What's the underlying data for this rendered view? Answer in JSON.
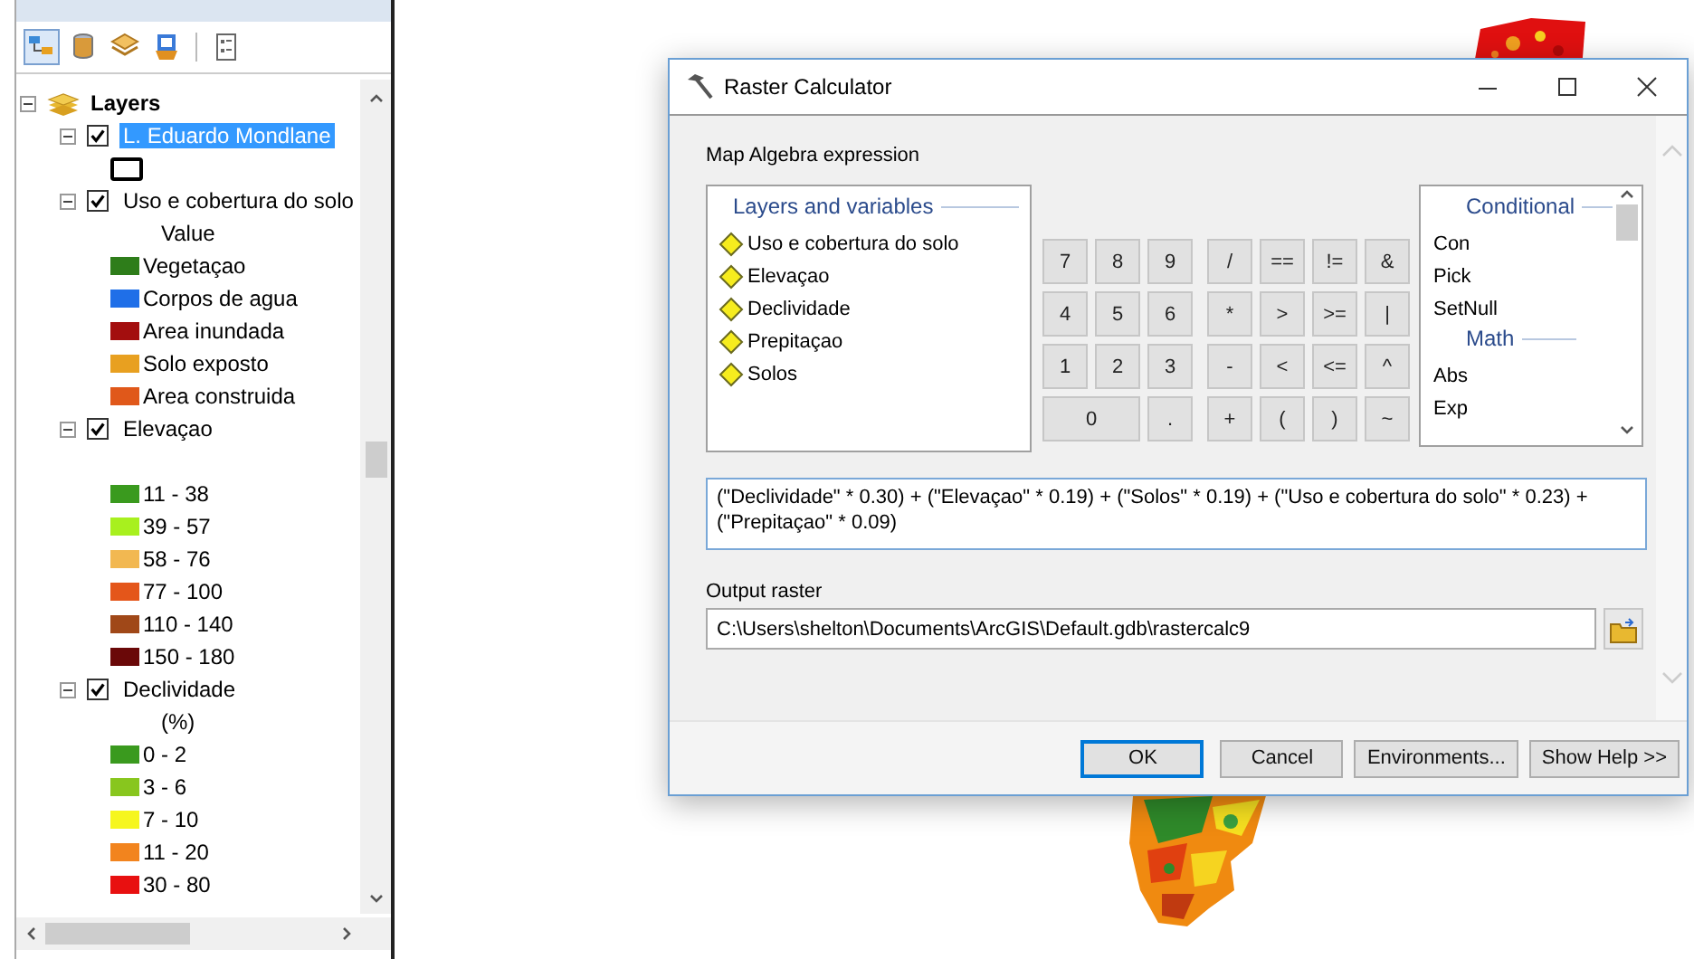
{
  "toc": {
    "toolbar": [
      {
        "kind": "drawing_order",
        "selected": true
      },
      {
        "kind": "source",
        "selected": false
      },
      {
        "kind": "visibility",
        "selected": false
      },
      {
        "kind": "selection",
        "selected": false
      },
      {
        "kind": "options",
        "selected": false
      }
    ],
    "tree": {
      "label": "Layers",
      "expanded": true,
      "children": [
        {
          "label": "L. Eduardo Mondlane",
          "checked": true,
          "expanded": true,
          "selected": true,
          "legend": [
            {
              "kind": "outline"
            }
          ]
        },
        {
          "label": "Uso e cobertura do solo",
          "checked": true,
          "expanded": true,
          "selected": false,
          "heading": "Value",
          "legend": [
            {
              "kind": "patch",
              "label": "Vegetaçao",
              "color": "#2e7d1a"
            },
            {
              "kind": "patch",
              "label": "Corpos de agua",
              "color": "#1f6fe8"
            },
            {
              "kind": "patch",
              "label": "Area inundada",
              "color": "#a30e0e"
            },
            {
              "kind": "patch",
              "label": "Solo exposto",
              "color": "#e8a020"
            },
            {
              "kind": "patch",
              "label": "Area construida",
              "color": "#e0581a"
            }
          ]
        },
        {
          "label": "Elevaçao",
          "checked": true,
          "expanded": true,
          "selected": false,
          "legend": [
            {
              "kind": "patch",
              "label": "11 - 38",
              "color": "#3a9a1e"
            },
            {
              "kind": "patch",
              "label": "39 - 57",
              "color": "#a8f01e"
            },
            {
              "kind": "patch",
              "label": "58 - 76",
              "color": "#f2b851"
            },
            {
              "kind": "patch",
              "label": "77 - 100",
              "color": "#e4561a"
            },
            {
              "kind": "patch",
              "label": "110 - 140",
              "color": "#a04818"
            },
            {
              "kind": "patch",
              "label": "150 - 180",
              "color": "#6a0808"
            }
          ]
        },
        {
          "label": "Declividade",
          "checked": true,
          "expanded": true,
          "selected": false,
          "heading": "(%)",
          "legend": [
            {
              "kind": "patch",
              "label": "0 - 2",
              "color": "#3a9a1e"
            },
            {
              "kind": "patch",
              "label": "3 - 6",
              "color": "#88c61e"
            },
            {
              "kind": "patch",
              "label": "7 - 10",
              "color": "#f6f61e"
            },
            {
              "kind": "patch",
              "label": "11 - 20",
              "color": "#f2841e"
            },
            {
              "kind": "patch",
              "label": "30 - 80",
              "color": "#e81010"
            }
          ]
        }
      ]
    }
  },
  "dialog": {
    "title": "Raster Calculator",
    "expression_label": "Map Algebra expression",
    "layers_box": {
      "title": "Layers and variables",
      "items": [
        "Uso e cobertura do solo",
        "Elevaçao",
        "Declividade",
        "Prepitaçao",
        "Solos"
      ]
    },
    "number_keys": [
      {
        "label": "7",
        "wide": false
      },
      {
        "label": "8",
        "wide": false
      },
      {
        "label": "9",
        "wide": false
      },
      {
        "label": "4",
        "wide": false
      },
      {
        "label": "5",
        "wide": false
      },
      {
        "label": "6",
        "wide": false
      },
      {
        "label": "1",
        "wide": false
      },
      {
        "label": "2",
        "wide": false
      },
      {
        "label": "3",
        "wide": false
      },
      {
        "label": "0",
        "wide": true
      },
      {
        "label": ".",
        "wide": false
      }
    ],
    "operator_keys": [
      "/",
      "==",
      "!=",
      "&",
      "*",
      ">",
      ">=",
      "|",
      "-",
      "<",
      "<=",
      "^",
      "+",
      "(",
      ")",
      "~"
    ],
    "tool_list": [
      {
        "title": "Conditional",
        "items": [
          "Con",
          "Pick",
          "SetNull"
        ]
      },
      {
        "title": "Math",
        "items": [
          "Abs",
          "Exp"
        ]
      }
    ],
    "expression": "(\"Declividade\" * 0.30) + (\"Elevaçao\" * 0.19) + (\"Solos\" * 0.19) + (\"Uso e cobertura do solo\" * 0.23) + (\"Prepitaçao\" * 0.09)",
    "output_label": "Output raster",
    "output_value": "C:\\Users\\shelton\\Documents\\ArcGIS\\Default.gdb\\rastercalc9",
    "buttons": [
      {
        "label": "OK",
        "default": true
      },
      {
        "label": "Cancel",
        "default": false
      },
      {
        "label": "Environments...",
        "default": false
      },
      {
        "label": "Show Help >>",
        "default": false
      }
    ]
  }
}
